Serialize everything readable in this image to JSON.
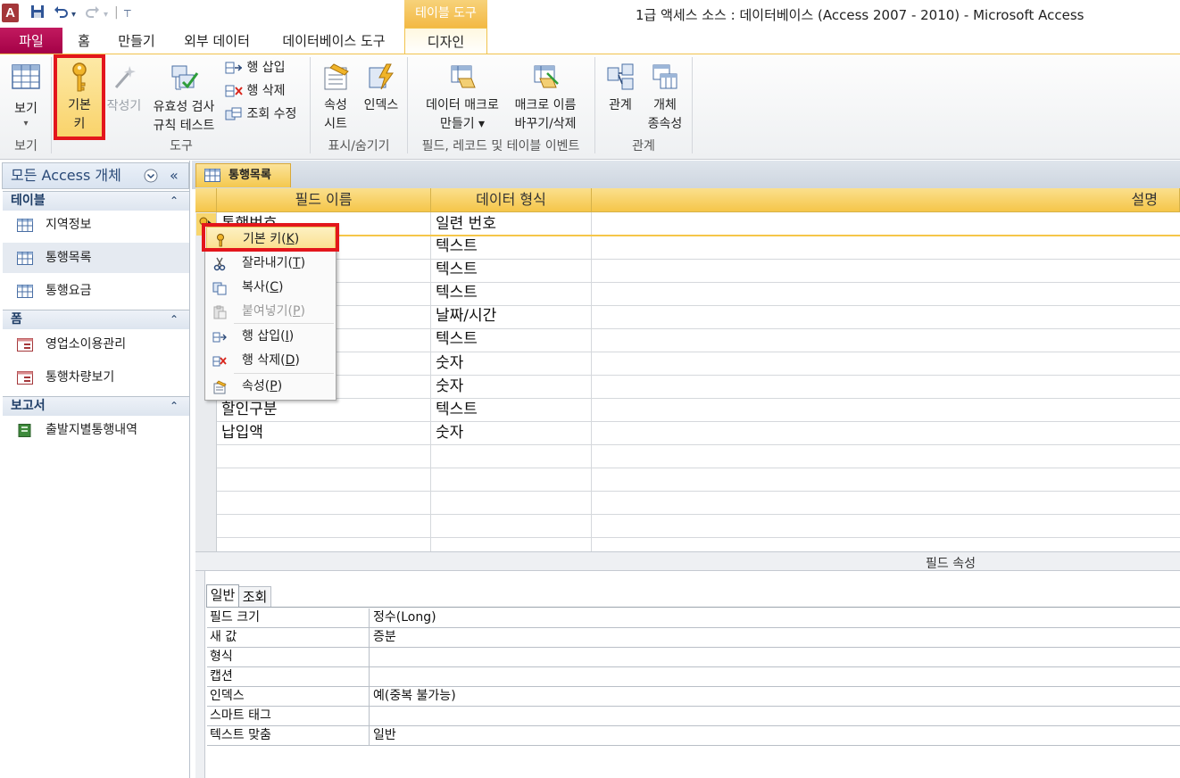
{
  "titlebar": {
    "app_icon": "A",
    "title": "1급 액세스 소스 : 데이터베이스 (Access 2007 - 2010)  -  Microsoft Access",
    "context_tab_title": "테이블 도구"
  },
  "ribbon_tabs": [
    "파일",
    "홈",
    "만들기",
    "외부 데이터",
    "데이터베이스 도구",
    "디자인"
  ],
  "ribbon": {
    "view": {
      "label": "보기",
      "dropdown": "▾",
      "group": "보기"
    },
    "tools": {
      "primary_key_line1": "기본",
      "primary_key_line2": "키",
      "builder": "작성기",
      "validation_line1": "유효성 검사",
      "validation_line2": "규칙 테스트",
      "insert_rows": "행 삽입",
      "delete_rows": "행 삭제",
      "modify_lookups": "조회 수정",
      "group": "도구"
    },
    "show_hide": {
      "property_sheet_line1": "속성",
      "property_sheet_line2": "시트",
      "indexes": "인덱스",
      "group": "표시/숨기기"
    },
    "events": {
      "data_macro_line1": "데이터 매크로",
      "data_macro_line2": "만들기 ▾",
      "rename_macro_line1": "매크로 이름",
      "rename_macro_line2": "바꾸기/삭제",
      "group": "필드, 레코드 및 테이블 이벤트"
    },
    "relationships": {
      "relationships": "관계",
      "dependencies_line1": "개체",
      "dependencies_line2": "종속성",
      "group": "관계"
    }
  },
  "nav": {
    "header": "모든 Access 개체",
    "sections": [
      {
        "title": "테이블",
        "items": [
          "지역정보",
          "통행목록",
          "통행요금"
        ]
      },
      {
        "title": "폼",
        "items": [
          "영업소이용관리",
          "통행차량보기"
        ]
      },
      {
        "title": "보고서",
        "items": [
          "출발지별통행내역"
        ]
      }
    ]
  },
  "document": {
    "tab": "통행목록",
    "headers": [
      "필드 이름",
      "데이터 형식",
      "설명"
    ],
    "rows": [
      {
        "field": "통행번호",
        "type": "일련 번호"
      },
      {
        "field": "",
        "type": "텍스트"
      },
      {
        "field": "",
        "type": "텍스트"
      },
      {
        "field": "",
        "type": "텍스트"
      },
      {
        "field": "",
        "type": "날짜/시간"
      },
      {
        "field": "",
        "type": "텍스트"
      },
      {
        "field": "",
        "type": "숫자"
      },
      {
        "field": "",
        "type": "숫자"
      },
      {
        "field": "할인구분",
        "type": "텍스트"
      },
      {
        "field": "납입액",
        "type": "숫자"
      }
    ]
  },
  "context_menu": [
    {
      "label": "기본 키",
      "key": "K",
      "icon": "key-icon",
      "disabled": false
    },
    {
      "label": "잘라내기",
      "key": "T",
      "icon": "scissors-icon",
      "disabled": false
    },
    {
      "label": "복사",
      "key": "C",
      "icon": "copy-icon",
      "disabled": false
    },
    {
      "label": "붙여넣기",
      "key": "P",
      "icon": "paste-icon",
      "disabled": true
    },
    {
      "label": "행 삽입",
      "key": "I",
      "icon": "insert-row-icon",
      "disabled": false
    },
    {
      "label": "행 삭제",
      "key": "D",
      "icon": "delete-row-icon",
      "disabled": false
    },
    {
      "label": "속성",
      "key": "P",
      "icon": "properties-icon",
      "disabled": false
    }
  ],
  "field_properties": {
    "title": "필드 속성",
    "tabs": [
      "일반",
      "조회"
    ],
    "rows": [
      {
        "name": "필드 크기",
        "value": "정수(Long)"
      },
      {
        "name": "새 값",
        "value": "증분"
      },
      {
        "name": "형식",
        "value": ""
      },
      {
        "name": "캡션",
        "value": ""
      },
      {
        "name": "인덱스",
        "value": "예(중복 불가능)"
      },
      {
        "name": "스마트 태그",
        "value": ""
      },
      {
        "name": "텍스트 맞춤",
        "value": "일반"
      }
    ]
  },
  "colors": {
    "file_tab": "#b4004e",
    "highlight": "#e3161c",
    "context_tab": "#f3b944"
  }
}
